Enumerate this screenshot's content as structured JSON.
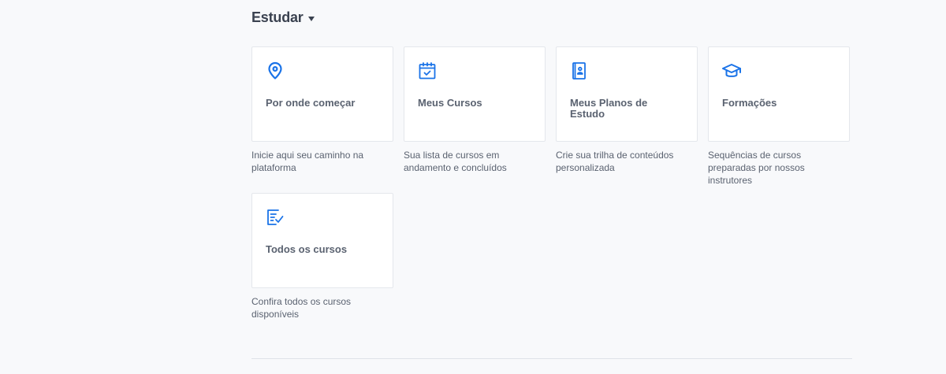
{
  "section": {
    "title": "Estudar",
    "caret_icon": "caret-down-icon"
  },
  "accent_color": "#1a73e8",
  "cards": [
    {
      "label": "Por onde começar",
      "description": "Inicie aqui seu caminho na plataforma",
      "icon": "map-pin-icon"
    },
    {
      "label": "Meus Cursos",
      "description": "Sua lista de cursos em andamento e concluídos",
      "icon": "calendar-check-icon"
    },
    {
      "label": "Meus Planos de Estudo",
      "description": "Crie sua trilha de conteúdos personalizada",
      "icon": "study-plan-book-icon"
    },
    {
      "label": "Formações",
      "description": "Sequências de cursos preparadas por nossos instrutores",
      "icon": "graduation-cap-icon"
    },
    {
      "label": "Todos os cursos",
      "description": "Confira todos os cursos disponíveis",
      "icon": "checklist-icon"
    }
  ]
}
